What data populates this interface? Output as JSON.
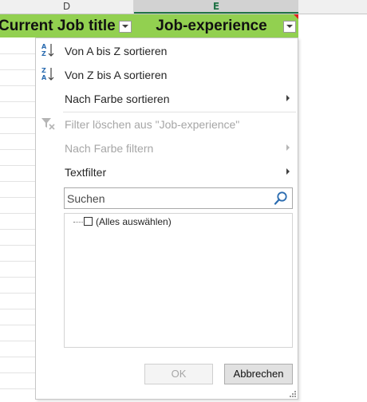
{
  "sheet": {
    "column_headers": [
      "D",
      "E"
    ],
    "header_cells": [
      "Current Job title",
      "Job-experience"
    ],
    "header_fill_color": "#92d050",
    "active_column_color": "#217346"
  },
  "menu": {
    "items": [
      {
        "label": "Von A bis Z sortieren",
        "icon": "sort-ascending-icon",
        "enabled": true,
        "submenu": false
      },
      {
        "label": "Von Z bis A sortieren",
        "icon": "sort-descending-icon",
        "enabled": true,
        "submenu": false
      },
      {
        "label": "Nach Farbe sortieren",
        "icon": "",
        "enabled": true,
        "submenu": true
      },
      {
        "label": "Filter löschen aus \"Job-experience\"",
        "icon": "clear-filter-icon",
        "enabled": false,
        "submenu": false
      },
      {
        "label": "Nach Farbe filtern",
        "icon": "",
        "enabled": false,
        "submenu": true
      },
      {
        "label": "Textfilter",
        "icon": "",
        "enabled": true,
        "submenu": true
      }
    ],
    "search": {
      "placeholder": "Suchen",
      "value": ""
    },
    "list": [
      {
        "label": "(Alles auswählen)",
        "checked": false
      }
    ],
    "buttons": {
      "ok": "OK",
      "cancel": "Abbrechen"
    }
  }
}
